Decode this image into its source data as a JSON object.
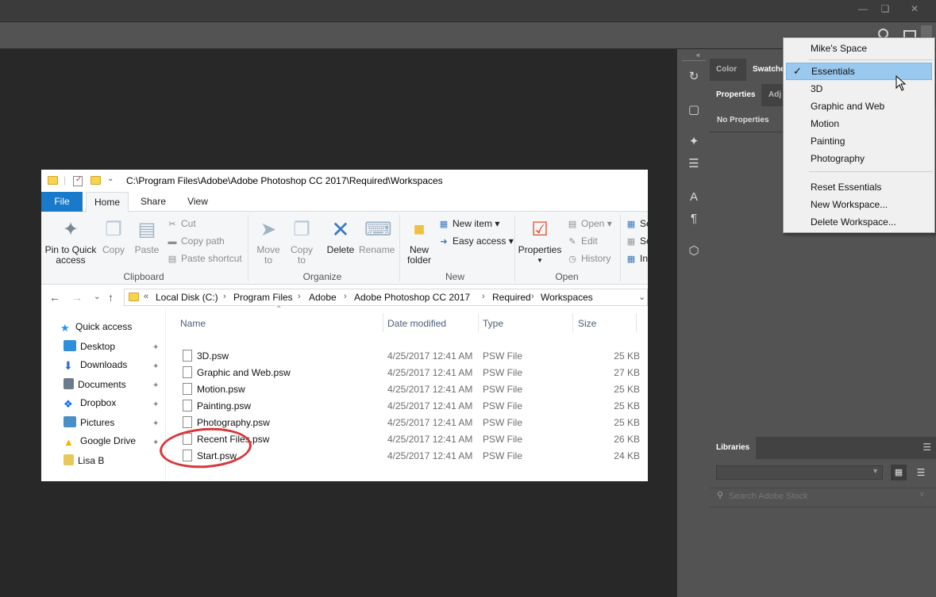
{
  "photoshop": {
    "panels": {
      "top_tabs": [
        "Color",
        "Swatche"
      ],
      "props_tabs": [
        "Properties",
        "Adj"
      ],
      "no_properties": "No Properties",
      "libraries_tab": "Libraries",
      "search_placeholder": "Search Adobe Stock"
    },
    "workspace_menu": {
      "items": [
        {
          "label": "Mike's Space",
          "checked": false
        },
        {
          "label": "Essentials",
          "checked": true,
          "highlighted": true
        },
        {
          "label": "3D",
          "checked": false
        },
        {
          "label": "Graphic and Web",
          "checked": false
        },
        {
          "label": "Motion",
          "checked": false
        },
        {
          "label": "Painting",
          "checked": false
        },
        {
          "label": "Photography",
          "checked": false
        }
      ],
      "actions": [
        "Reset Essentials",
        "New Workspace...",
        "Delete Workspace..."
      ]
    }
  },
  "explorer": {
    "title_path": "C:\\Program Files\\Adobe\\Adobe Photoshop CC 2017\\Required\\Workspaces",
    "tabs": {
      "file": "File",
      "home": "Home",
      "share": "Share",
      "view": "View"
    },
    "ribbon": {
      "clipboard": {
        "pin": "Pin to Quick access",
        "copy": "Copy",
        "paste": "Paste",
        "cut": "Cut",
        "copy_path": "Copy path",
        "paste_shortcut": "Paste shortcut",
        "label": "Clipboard"
      },
      "organize": {
        "move_to": "Move to",
        "copy_to": "Copy to",
        "delete": "Delete",
        "rename": "Rename",
        "label": "Organize"
      },
      "new": {
        "new_folder": "New folder",
        "new_item": "New item",
        "easy_access": "Easy access",
        "label": "New"
      },
      "open": {
        "properties": "Properties",
        "open": "Open",
        "edit": "Edit",
        "history": "History",
        "label": "Open"
      },
      "select": {
        "s1": "Se",
        "s2": "Se",
        "s3": "In"
      }
    },
    "breadcrumb": [
      "Local Disk (C:)",
      "Program Files",
      "Adobe",
      "Adobe Photoshop CC 2017",
      "Required",
      "Workspaces"
    ],
    "nav": [
      {
        "label": "Quick access",
        "color": "#1e90ff"
      },
      {
        "label": "Desktop",
        "color": "#2f8fdc"
      },
      {
        "label": "Downloads",
        "color": "#2f6fcf"
      },
      {
        "label": "Documents",
        "color": "#6c7b8b"
      },
      {
        "label": "Dropbox",
        "color": "#0061fe"
      },
      {
        "label": "Pictures",
        "color": "#4a90c6"
      },
      {
        "label": "Google Drive",
        "color": "#f4b400"
      },
      {
        "label": "Lisa B",
        "color": "#e8c85a"
      }
    ],
    "columns": {
      "name": "Name",
      "date": "Date modified",
      "type": "Type",
      "size": "Size"
    },
    "files": [
      {
        "name": "3D.psw",
        "date": "4/25/2017 12:41 AM",
        "type": "PSW File",
        "size": "25 KB"
      },
      {
        "name": "Graphic and Web.psw",
        "date": "4/25/2017 12:41 AM",
        "type": "PSW File",
        "size": "27 KB"
      },
      {
        "name": "Motion.psw",
        "date": "4/25/2017 12:41 AM",
        "type": "PSW File",
        "size": "25 KB"
      },
      {
        "name": "Painting.psw",
        "date": "4/25/2017 12:41 AM",
        "type": "PSW File",
        "size": "25 KB"
      },
      {
        "name": "Photography.psw",
        "date": "4/25/2017 12:41 AM",
        "type": "PSW File",
        "size": "25 KB"
      },
      {
        "name": "Recent Files.psw",
        "date": "4/25/2017 12:41 AM",
        "type": "PSW File",
        "size": "26 KB"
      },
      {
        "name": "Start.psw",
        "date": "4/25/2017 12:41 AM",
        "type": "PSW File",
        "size": "24 KB"
      }
    ],
    "accent_color": "#1979ca",
    "annotation_color": "#d7373b"
  }
}
